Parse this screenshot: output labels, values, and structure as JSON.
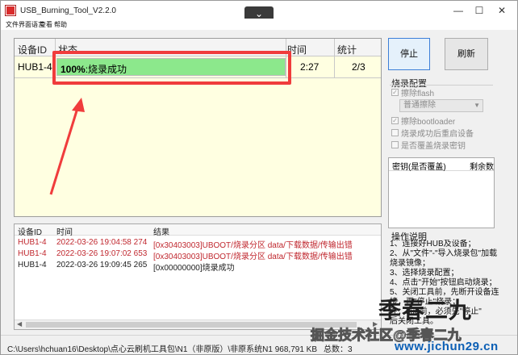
{
  "window": {
    "title": "USB_Burning_Tool_V2.2.0",
    "center_button": "⌄"
  },
  "menu": [
    "文件",
    "界面语言",
    "查看",
    "帮助"
  ],
  "grid": {
    "columns": [
      "设备ID",
      "状态",
      "时间",
      "统计"
    ],
    "row": {
      "device": "HUB1-4",
      "progress_pct": "100%",
      "progress_fraction": 1.0,
      "status_text": ":烧录成功",
      "time": "2:27",
      "stat": "2/3"
    }
  },
  "buttons": {
    "stop": "停止",
    "refresh": "刷新"
  },
  "config": {
    "title": "烧录配置",
    "erase_flash": "擦除flash",
    "erase_mode": "普通擦除",
    "erase_bootloader": "擦除bootloader",
    "reset_after": "烧录成功后重启设备",
    "overwrite_key": "是否覆盖烧录密钥"
  },
  "key_table": {
    "col1": "密钥(是否覆盖)",
    "col2": "剩余数"
  },
  "help": {
    "title": "操作说明",
    "lines": [
      "1、连接好HUB及设备；",
      "2、从\"文件\"-\"导入烧录包\"加载",
      "烧录镜像；",
      "3、选择烧录配置；",
      "4、点击\"开始\"按钮启动烧录；",
      "5、关闭工具前，先断开设备连",
      "   接，再\"停止\"烧录；",
      "   注：hub前，必须先\"停止\"",
      "   后关闭工具。"
    ]
  },
  "log": {
    "columns": [
      "设备ID",
      "时间",
      "结果"
    ],
    "rows": [
      {
        "device": "HUB1-4",
        "time": "2022-03-26 19:04:58 274",
        "result": "[0x30403003]UBOOT/烧录分区 data/下载数据/传输出错",
        "level": "error"
      },
      {
        "device": "HUB1-4",
        "time": "2022-03-26 19:07:02 653",
        "result": "[0x30403003]UBOOT/烧录分区 data/下载数据/传输出错",
        "level": "error"
      },
      {
        "device": "HUB1-4",
        "time": "2022-03-26 19:09:45 265",
        "result": "[0x00000000]烧录成功",
        "level": "ok"
      }
    ]
  },
  "status": {
    "path": "C:\\Users\\hchuan16\\Desktop\\点心云刷机工具包\\N1（非原版）\\非原系统N1 968,791 KB",
    "total": "总数：3"
  },
  "watermark": {
    "big": "季春二九",
    "line": "掘金技术社区@季春二九",
    "url": "www.jichun29.cn"
  },
  "colors": {
    "progress": "#8ce88c",
    "highlight": "#f03c3c",
    "error_text": "#c0282f",
    "grid_bg": "#ffffe1"
  }
}
